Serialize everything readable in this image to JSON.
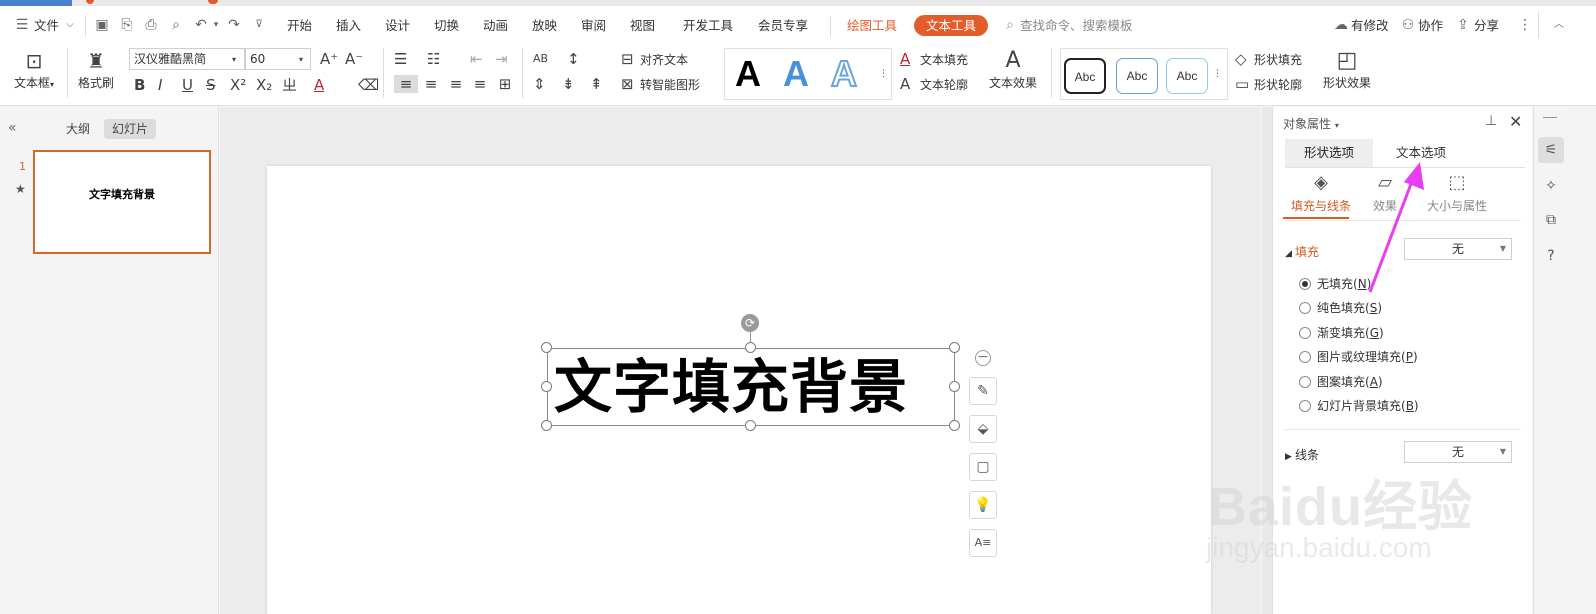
{
  "menubar": {
    "file_label": "文件",
    "tabs": [
      "开始",
      "插入",
      "设计",
      "切换",
      "动画",
      "放映",
      "审阅",
      "视图",
      "开发工具",
      "会员专享"
    ],
    "drawing_tools": "绘图工具",
    "text_tools": "文本工具",
    "search_placeholder": "查找命令、搜索模板",
    "modified": "有修改",
    "collab": "协作",
    "share": "分享"
  },
  "ribbon": {
    "textbox_label": "文本框",
    "format_painter": "格式刷",
    "font_name": "汉仪雅酷黑简",
    "font_size": "60",
    "align_text": "对齐文本",
    "smart_shape": "转智能图形",
    "text_fill": "文本填充",
    "text_outline": "文本轮廓",
    "text_effect": "文本效果",
    "abc": [
      "Abc",
      "Abc",
      "Abc"
    ],
    "shape_fill": "形状填充",
    "shape_outline": "形状轮廓",
    "shape_effect": "形状效果"
  },
  "left_pane": {
    "tab_outline": "大纲",
    "tab_slides": "幻灯片",
    "slide_number": "1",
    "thumb_text": "文字填充背景"
  },
  "slide": {
    "text": "文字填充背景"
  },
  "props": {
    "title": "对象属性",
    "tab_shape": "形状选项",
    "tab_text": "文本选项",
    "sub_fill_line": "填充与线条",
    "sub_effect": "效果",
    "sub_size": "大小与属性",
    "fill_label": "填充",
    "fill_value": "无",
    "options": [
      {
        "label": "无填充(",
        "key": "N",
        "checked": true
      },
      {
        "label": "纯色填充(",
        "key": "S",
        "checked": false
      },
      {
        "label": "渐变填充(",
        "key": "G",
        "checked": false
      },
      {
        "label": "图片或纹理填充(",
        "key": "P",
        "checked": false
      },
      {
        "label": "图案填充(",
        "key": "A",
        "checked": false
      },
      {
        "label": "幻灯片背景填充(",
        "key": "B",
        "checked": false
      }
    ],
    "line_label": "线条",
    "line_value": "无"
  },
  "watermark": {
    "main": "Baidu经验",
    "sub": "jingyan.baidu.com"
  },
  "colors": {
    "accent": "#e35d2c",
    "annotation": "#e83df0"
  }
}
